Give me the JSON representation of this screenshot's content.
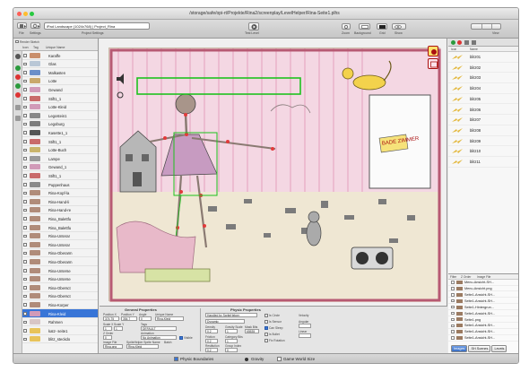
{
  "window": {
    "title": "/storage/safe/opi-rt/Projekte/Rina2/screenplay/LevelHelper/Rina-Seite1.plhs"
  },
  "toolbar": {
    "file_label": "File",
    "settings_label": "Settings",
    "scene_select": "iPad Landscape (1024x768) | Project_Rina",
    "project_settings_label": "Project Settings",
    "test_level_label": "Test Level",
    "zoom_label": "Zoom",
    "background_label": "Background",
    "grid_label": "Grid",
    "show_label": "Show",
    "view_label": "View"
  },
  "sidebar": {
    "header": "Render Sketch",
    "columns": [
      "Icon",
      "Tag",
      "Unique Name"
    ],
    "items": [
      {
        "name": "Karaffe",
        "color": "#c98e6b"
      },
      {
        "name": "Glas",
        "color": "#b9c7d6"
      },
      {
        "name": "Malkasten",
        "color": "#6b8fc9"
      },
      {
        "name": "Lotte",
        "color": "#c9a86b"
      },
      {
        "name": "Gewand",
        "color": "#d19ab8"
      },
      {
        "name": "Stift1_1",
        "color": "#c96b6b"
      },
      {
        "name": "Lotte-Kleid",
        "color": "#d19ab8"
      },
      {
        "name": "Legostein1",
        "color": "#888888"
      },
      {
        "name": "Legoburg",
        "color": "#7c7c7c"
      },
      {
        "name": "Kasette1_1",
        "color": "#555555"
      },
      {
        "name": "Stift1_1",
        "color": "#c96b6b"
      },
      {
        "name": "Lotte-Buch",
        "color": "#c9b46b"
      },
      {
        "name": "Lampe",
        "color": "#9a9a9a"
      },
      {
        "name": "Gewand_1",
        "color": "#d19ab8"
      },
      {
        "name": "Stift1_1",
        "color": "#c96b6b"
      },
      {
        "name": "Puppenhaus",
        "color": "#8a8a8a"
      },
      {
        "name": "Rina-Kopf-la",
        "color": "#b08c7a"
      },
      {
        "name": "Rina-Hand-li",
        "color": "#b08c7a"
      },
      {
        "name": "Rina-Hand-re",
        "color": "#b08c7a"
      },
      {
        "name": "Rina_Balettfu",
        "color": "#b08c7a"
      },
      {
        "name": "Rina_Balettfu",
        "color": "#b08c7a"
      },
      {
        "name": "Rina-Unterar",
        "color": "#b08c7a"
      },
      {
        "name": "Rina-Unterar",
        "color": "#b08c7a"
      },
      {
        "name": "Rina-Oberarm",
        "color": "#b08c7a"
      },
      {
        "name": "Rina-Oberarm",
        "color": "#b08c7a"
      },
      {
        "name": "Rina-Unterse",
        "color": "#b08c7a"
      },
      {
        "name": "Rina-Unterse",
        "color": "#b08c7a"
      },
      {
        "name": "Rina-Obersct",
        "color": "#b08c7a"
      },
      {
        "name": "Rina-Obersct",
        "color": "#b08c7a"
      },
      {
        "name": "Rina-Korper",
        "color": "#b08c7a"
      },
      {
        "name": "Rina-Kleid",
        "color": "#d19ab8"
      },
      {
        "name": "Rahmen",
        "color": "#d8c6c6"
      },
      {
        "name": "katz- seite1",
        "color": "#e8c35a"
      },
      {
        "name": "blitz_steckdo",
        "color": "#e8c35a"
      }
    ],
    "selected_index": 30
  },
  "properties": {
    "general_title": "General Properties",
    "position_x_label": "Position X",
    "position_x": "374.75",
    "position_y_label": "Position Y",
    "position_y": "354.7",
    "angle_label": "Angle",
    "angle": "0",
    "unique_name_label": "Unique Name",
    "unique_name": "Rina-Kleid",
    "scale_x_label": "Scale X",
    "scale_x": "1",
    "scale_y_label": "Scale Y",
    "scale_y": "1",
    "tags_label": "Tags",
    "tags_value": "DEFAULT",
    "animation_label": "Animation",
    "animation_value": "No Animation",
    "visible_label": "Visible",
    "z_order_label": "Z Order",
    "z_order": "0",
    "image_file_label": "Image File",
    "image_file": "Rina.png",
    "sprite_name_label": "SpriteHelper Sprite Name",
    "sprite_name": "Rina-Kleid",
    "batch_label": "Batch",
    "physic_title": "Physic Properties",
    "handled_label": "Handled by SpriteHelper",
    "body_type": "Dynamic",
    "density_label": "Density",
    "density": "0.2",
    "friction_label": "Friction",
    "friction": "0.2",
    "restitution_label": "Restitution",
    "restitution": "0.2",
    "gravity_scale_label": "Gravity Scale",
    "gravity_scale": "1",
    "mask_bits_label": "Mask Bits",
    "mask_bits": "65535",
    "category_bits_label": "Category Bits",
    "category_bits": "1",
    "group_index_label": "Group Index",
    "group_index": "0",
    "velocity_label": "Velocity",
    "is_circle_label": "Is Circle",
    "is_sensor_label": "Is Sensor",
    "can_sleep_label": "Can Sleep",
    "is_bullet_label": "Is Bullet",
    "fix_rotation_label": "Fix Rotation",
    "angular_label": "Angular",
    "linear_label": "Linear"
  },
  "footer": {
    "physic_boundaries_label": "Physic Boundaries",
    "gravity_label": "Gravity",
    "game_world_size_label": "Game World Size"
  },
  "right_panel": {
    "col_icon": "Icon",
    "col_name": "Name",
    "images": [
      "blitz01",
      "blitz02",
      "blitz03",
      "blitz04",
      "blitz05",
      "blitz06",
      "blitz07",
      "blitz08",
      "blitz09",
      "blitz10",
      "blitz11"
    ],
    "lower_headers": [
      "Filter",
      "Z Order",
      "Image File"
    ],
    "lower_rows": [
      "Menu-Ansicht-SH...",
      "Menu-Ansicht.png",
      "Seite1-Ansicht-SH...",
      "Seite1-Ansicht-SH...",
      "Seite1-Hintergrun...",
      "Seite1-Ansicht-SH...",
      "Seite1.png",
      "Seite1-Ansicht-SH...",
      "Seite1-Ansicht-SH...",
      "Seite1-Ansicht-SH..."
    ],
    "tabs": [
      "Images",
      "SH Scenes",
      "Levels"
    ],
    "active_tab": "Images"
  },
  "scene": {
    "door_sign": "BADE ZIMMER"
  },
  "colors": {
    "selection": "#3875d7",
    "outline_green": "#1ec21e",
    "joint_red": "#e23b3b"
  }
}
